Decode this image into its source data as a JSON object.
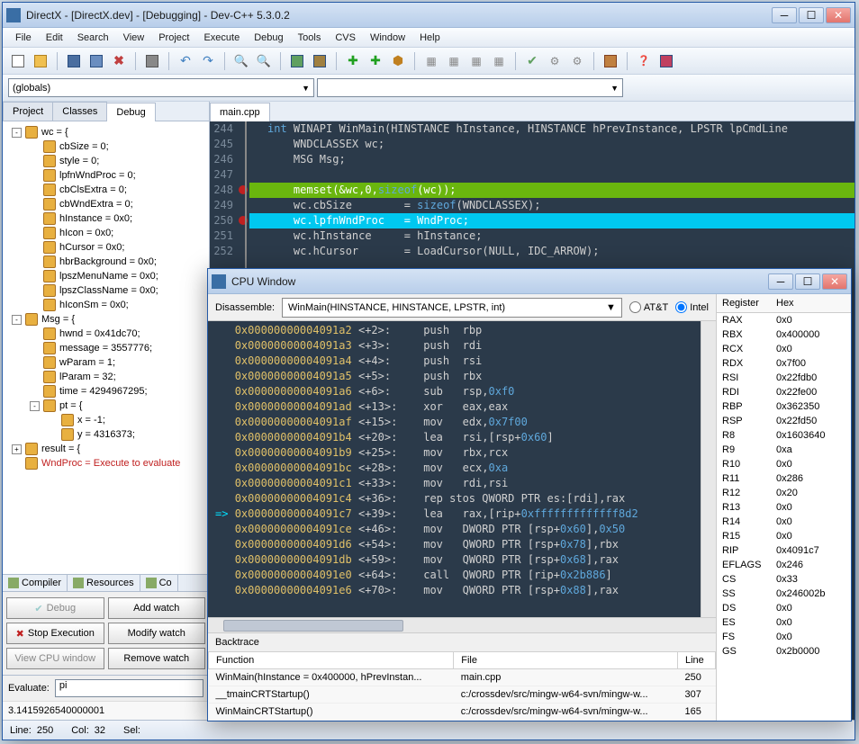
{
  "window": {
    "title": "DirectX - [DirectX.dev] - [Debugging] - Dev-C++ 5.3.0.2"
  },
  "menu": [
    "File",
    "Edit",
    "Search",
    "View",
    "Project",
    "Execute",
    "Debug",
    "Tools",
    "CVS",
    "Window",
    "Help"
  ],
  "combo_globals": "(globals)",
  "side_tabs": [
    "Project",
    "Classes",
    "Debug"
  ],
  "side_tab_active": 2,
  "tree": [
    {
      "d": 0,
      "t": "-",
      "l": "wc = {"
    },
    {
      "d": 1,
      "l": "cbSize = 0;"
    },
    {
      "d": 1,
      "l": "style = 0;"
    },
    {
      "d": 1,
      "l": "lpfnWndProc = 0;"
    },
    {
      "d": 1,
      "l": "cbClsExtra = 0;"
    },
    {
      "d": 1,
      "l": "cbWndExtra = 0;"
    },
    {
      "d": 1,
      "l": "hInstance = 0x0;"
    },
    {
      "d": 1,
      "l": "hIcon = 0x0;"
    },
    {
      "d": 1,
      "l": "hCursor = 0x0;"
    },
    {
      "d": 1,
      "l": "hbrBackground = 0x0;"
    },
    {
      "d": 1,
      "l": "lpszMenuName = 0x0;"
    },
    {
      "d": 1,
      "l": "lpszClassName = 0x0;"
    },
    {
      "d": 1,
      "l": "hIconSm = 0x0;"
    },
    {
      "d": 0,
      "t": "-",
      "l": "Msg = {"
    },
    {
      "d": 1,
      "l": "hwnd = 0x41dc70;"
    },
    {
      "d": 1,
      "l": "message = 3557776;"
    },
    {
      "d": 1,
      "l": "wParam = 1;"
    },
    {
      "d": 1,
      "l": "lParam = 32;"
    },
    {
      "d": 1,
      "l": "time = 4294967295;"
    },
    {
      "d": 1,
      "t": "-",
      "l": "pt = {"
    },
    {
      "d": 2,
      "l": "x = -1;"
    },
    {
      "d": 2,
      "l": "y = 4316373;"
    },
    {
      "d": 0,
      "t": "+",
      "l": "result = {"
    },
    {
      "d": 0,
      "l": "WndProc = Execute to evaluate",
      "red": true
    }
  ],
  "mini_tabs": [
    "Compiler",
    "Resources",
    "Co"
  ],
  "dbg": {
    "debug": "Debug",
    "add_watch": "Add watch",
    "stop": "Stop Execution",
    "modify": "Modify watch",
    "cpu": "View CPU window",
    "remove": "Remove watch"
  },
  "evaluate_label": "Evaluate:",
  "evaluate_input": "pi",
  "evaluate_result": "3.1415926540000001",
  "status": {
    "line_lbl": "Line:",
    "line": "250",
    "col_lbl": "Col:",
    "col": "32",
    "sel_lbl": "Sel:"
  },
  "editor_tab": "main.cpp",
  "code": [
    {
      "n": 244,
      "html": "<span class='kw'>int</span> WINAPI WinMain(HINSTANCE hInstance, HINSTANCE hPrevInstance, LPSTR lpCmdLine"
    },
    {
      "n": 245,
      "html": "    WNDCLASSEX wc;"
    },
    {
      "n": 246,
      "html": "    MSG Msg;"
    },
    {
      "n": 247,
      "html": ""
    },
    {
      "n": 248,
      "bp": true,
      "cls": "hl-green",
      "html": "    memset(&wc,0,<span class='kw'>sizeof</span>(wc));"
    },
    {
      "n": 249,
      "html": "    wc.cbSize        = <span class='kw'>sizeof</span>(WNDCLASSEX);"
    },
    {
      "n": 250,
      "bp": true,
      "cls": "hl-cyan",
      "html": "    wc.lpfnWndProc   = WndProc;"
    },
    {
      "n": 251,
      "html": "    wc.hInstance     = hInstance;"
    },
    {
      "n": 252,
      "html": "    wc.hCursor       = LoadCursor(NULL, IDC_ARROW);"
    }
  ],
  "cpu": {
    "title": "CPU Window",
    "disassemble_label": "Disassemble:",
    "disassemble_value": "WinMain(HINSTANCE, HINSTANCE, LPSTR, int)",
    "radio_att": "AT&T",
    "radio_intel": "Intel",
    "backtrace_label": "Backtrace",
    "bt_cols": [
      "Function",
      "File",
      "Line"
    ],
    "bt_rows": [
      {
        "f": "WinMain(hInstance = 0x400000, hPrevInstan...",
        "file": "main.cpp",
        "line": "250"
      },
      {
        "f": "__tmainCRTStartup()",
        "file": "c:/crossdev/src/mingw-w64-svn/mingw-w...",
        "line": "307"
      },
      {
        "f": "WinMainCRTStartup()",
        "file": "c:/crossdev/src/mingw-w64-svn/mingw-w...",
        "line": "165"
      }
    ]
  },
  "disasm": [
    {
      "a": "0x00000000004091a2",
      "o": "<+2>:",
      "m": "push",
      "r": "rbp"
    },
    {
      "a": "0x00000000004091a3",
      "o": "<+3>:",
      "m": "push",
      "r": "rdi"
    },
    {
      "a": "0x00000000004091a4",
      "o": "<+4>:",
      "m": "push",
      "r": "rsi"
    },
    {
      "a": "0x00000000004091a5",
      "o": "<+5>:",
      "m": "push",
      "r": "rbx"
    },
    {
      "a": "0x00000000004091a6",
      "o": "<+6>:",
      "m": "sub",
      "r": "rsp,",
      "h": "0xf0"
    },
    {
      "a": "0x00000000004091ad",
      "o": "<+13>:",
      "m": "xor",
      "r": "eax,eax"
    },
    {
      "a": "0x00000000004091af",
      "o": "<+15>:",
      "m": "mov",
      "r": "edx,",
      "h": "0x7f00"
    },
    {
      "a": "0x00000000004091b4",
      "o": "<+20>:",
      "m": "lea",
      "r": "rsi,[rsp+",
      "h": "0x60",
      "r2": "]"
    },
    {
      "a": "0x00000000004091b9",
      "o": "<+25>:",
      "m": "mov",
      "r": "rbx,rcx"
    },
    {
      "a": "0x00000000004091bc",
      "o": "<+28>:",
      "m": "mov",
      "r": "ecx,",
      "h": "0xa"
    },
    {
      "a": "0x00000000004091c1",
      "o": "<+33>:",
      "m": "mov",
      "r": "rdi,rsi"
    },
    {
      "a": "0x00000000004091c4",
      "o": "<+36>:",
      "m": "rep stos QWORD PTR es:[rdi],rax"
    },
    {
      "a": "0x00000000004091c7",
      "o": "<+39>:",
      "cur": true,
      "m": "lea",
      "r": "rax,[rip+",
      "h": "0xfffffffffffff8d2"
    },
    {
      "a": "0x00000000004091ce",
      "o": "<+46>:",
      "m": "mov",
      "r": "DWORD PTR [rsp+",
      "h": "0x60",
      "r2": "],",
      "h2": "0x50"
    },
    {
      "a": "0x00000000004091d6",
      "o": "<+54>:",
      "m": "mov",
      "r": "QWORD PTR [rsp+",
      "h": "0x78",
      "r2": "],rbx"
    },
    {
      "a": "0x00000000004091db",
      "o": "<+59>:",
      "m": "mov",
      "r": "QWORD PTR [rsp+",
      "h": "0x68",
      "r2": "],rax"
    },
    {
      "a": "0x00000000004091e0",
      "o": "<+64>:",
      "m": "call",
      "r": "QWORD PTR [rip+",
      "h": "0x2b886",
      "r2": "]"
    },
    {
      "a": "0x00000000004091e6",
      "o": "<+70>:",
      "m": "mov",
      "r": "QWORD PTR [rsp+",
      "h": "0x88",
      "r2": "],rax"
    }
  ],
  "reg_hdr": {
    "r": "Register",
    "h": "Hex"
  },
  "registers": [
    {
      "r": "RAX",
      "v": "0x0"
    },
    {
      "r": "RBX",
      "v": "0x400000"
    },
    {
      "r": "RCX",
      "v": "0x0"
    },
    {
      "r": "RDX",
      "v": "0x7f00"
    },
    {
      "r": "RSI",
      "v": "0x22fdb0"
    },
    {
      "r": "RDI",
      "v": "0x22fe00"
    },
    {
      "r": "RBP",
      "v": "0x362350"
    },
    {
      "r": "RSP",
      "v": "0x22fd50"
    },
    {
      "r": "R8",
      "v": "0x1603640"
    },
    {
      "r": "R9",
      "v": "0xa"
    },
    {
      "r": "R10",
      "v": "0x0"
    },
    {
      "r": "R11",
      "v": "0x286"
    },
    {
      "r": "R12",
      "v": "0x20"
    },
    {
      "r": "R13",
      "v": "0x0"
    },
    {
      "r": "R14",
      "v": "0x0"
    },
    {
      "r": "R15",
      "v": "0x0"
    },
    {
      "r": "RIP",
      "v": "0x4091c7"
    },
    {
      "r": "EFLAGS",
      "v": "0x246"
    },
    {
      "r": "CS",
      "v": "0x33"
    },
    {
      "r": "SS",
      "v": "0x246002b"
    },
    {
      "r": "DS",
      "v": "0x0"
    },
    {
      "r": "ES",
      "v": "0x0"
    },
    {
      "r": "FS",
      "v": "0x0"
    },
    {
      "r": "GS",
      "v": "0x2b0000"
    }
  ]
}
